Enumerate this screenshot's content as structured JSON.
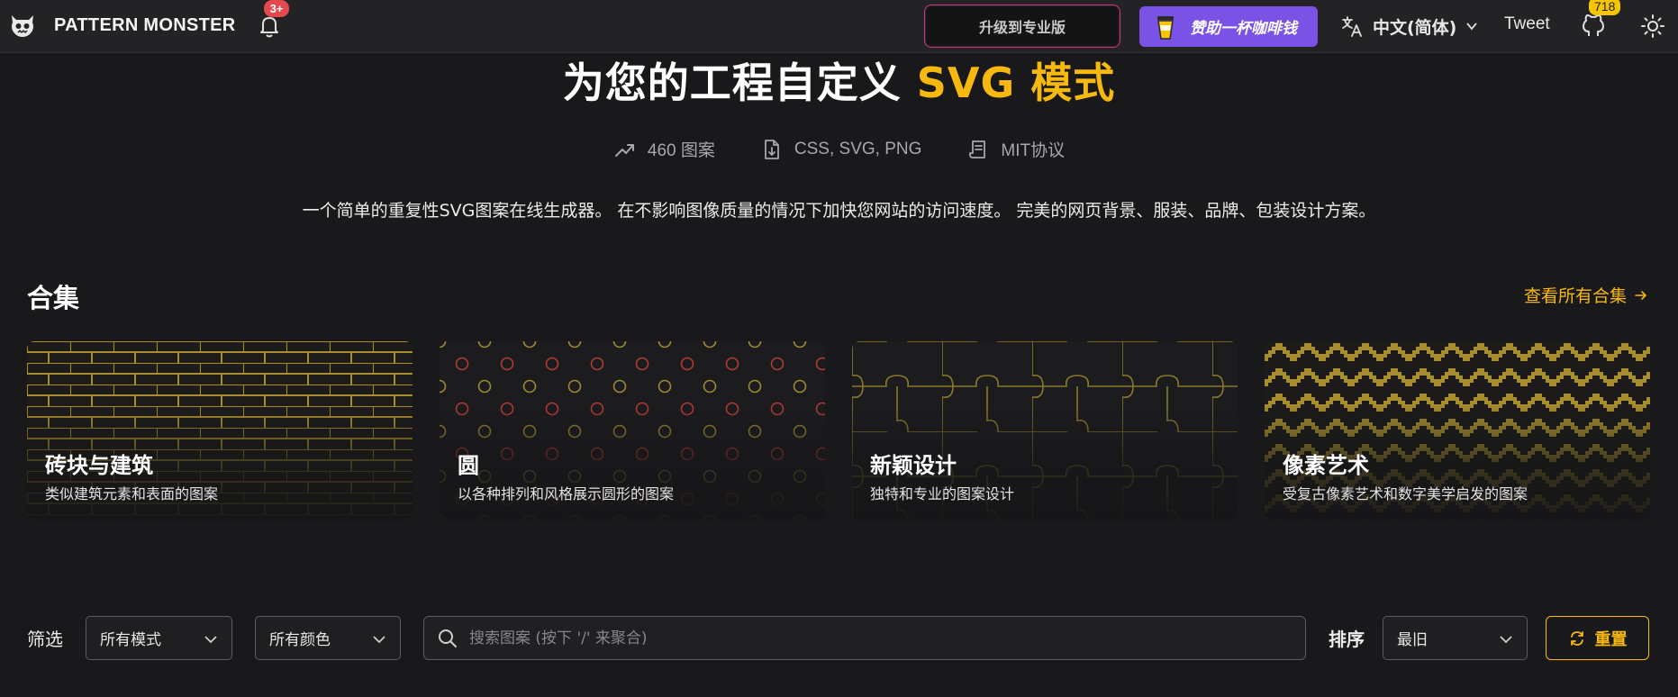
{
  "nav": {
    "brand": "PATTERN MONSTER",
    "notification_badge": "3+",
    "upgrade_label": "升级到专业版",
    "coffee_label": "赞助一杯咖啡钱",
    "language_label": "中文(简体)",
    "tweet_label": "Tweet",
    "github_stars": "718",
    "icons": [
      "monster-logo-icon",
      "bell-icon",
      "coffee-cup-icon",
      "translate-icon",
      "chevron-down-icon",
      "github-icon",
      "sun-icon"
    ]
  },
  "hero": {
    "title_main": "为您的工程自定义 ",
    "title_highlight": "SVG 模式",
    "stats": [
      {
        "icon": "trending-up-icon",
        "label": "460 图案"
      },
      {
        "icon": "file-download-icon",
        "label": "CSS, SVG, PNG"
      },
      {
        "icon": "license-icon",
        "label": "MIT协议"
      }
    ],
    "tagline": "一个简单的重复性SVG图案在线生成器。 在不影响图像质量的情况下加快您网站的访问速度。 完美的网页背景、服装、品牌、包装设计方案。"
  },
  "collections": {
    "heading": "合集",
    "view_all": "查看所有合集",
    "items": [
      {
        "title": "砖块与建筑",
        "desc": "类似建筑元素和表面的图案"
      },
      {
        "title": "圆",
        "desc": "以各种排列和风格展示圆形的图案"
      },
      {
        "title": "新颖设计",
        "desc": "独特和专业的图案设计"
      },
      {
        "title": "像素艺术",
        "desc": "受复古像素艺术和数字美学启发的图案"
      }
    ]
  },
  "filters": {
    "label": "筛选",
    "mode_selected": "所有模式",
    "color_selected": "所有颜色",
    "search_placeholder": "搜索图案 (按下 '/' 来聚合)",
    "sort_label": "排序",
    "sort_selected": "最旧",
    "reset_label": "重置"
  },
  "colors": {
    "accent": "#f7b90f",
    "purple": "#7a52e6",
    "background": "#19191b",
    "badge_red": "#e5484d"
  }
}
